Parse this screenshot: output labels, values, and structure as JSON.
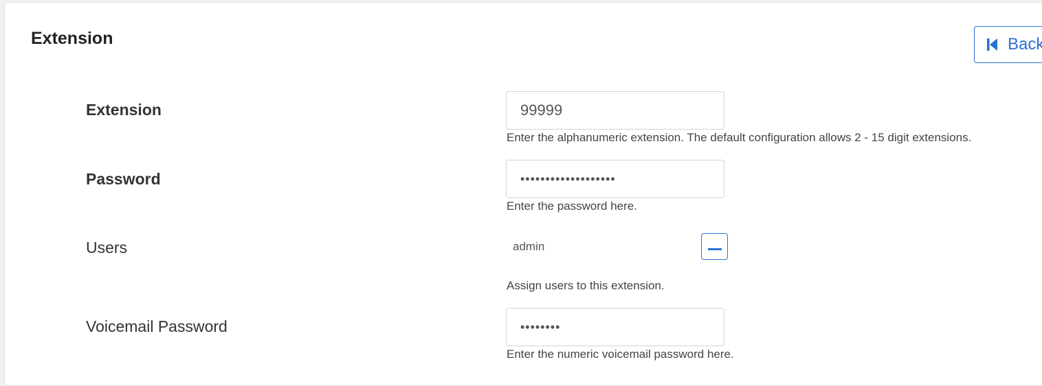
{
  "page": {
    "title": "Extension"
  },
  "toolbar": {
    "back_label": "Back"
  },
  "colors": {
    "accent": "#2c6fd6",
    "card_background": "#ffffff",
    "page_background": "#f1f1f1"
  },
  "form": {
    "extension": {
      "label": "Extension",
      "value": "99999",
      "help": "Enter the alphanumeric extension. The default configuration allows 2 - 15 digit extensions."
    },
    "password": {
      "label": "Password",
      "value": "•••••••••••••••••••",
      "help": "Enter the password here."
    },
    "users": {
      "label": "Users",
      "assigned": [
        "admin"
      ],
      "help": "Assign users to this extension."
    },
    "voicemail_password": {
      "label": "Voicemail Password",
      "value": "••••••••",
      "help": "Enter the numeric voicemail password here."
    }
  },
  "icons": {
    "back": "skip-back-icon",
    "remove": "minus-icon"
  }
}
